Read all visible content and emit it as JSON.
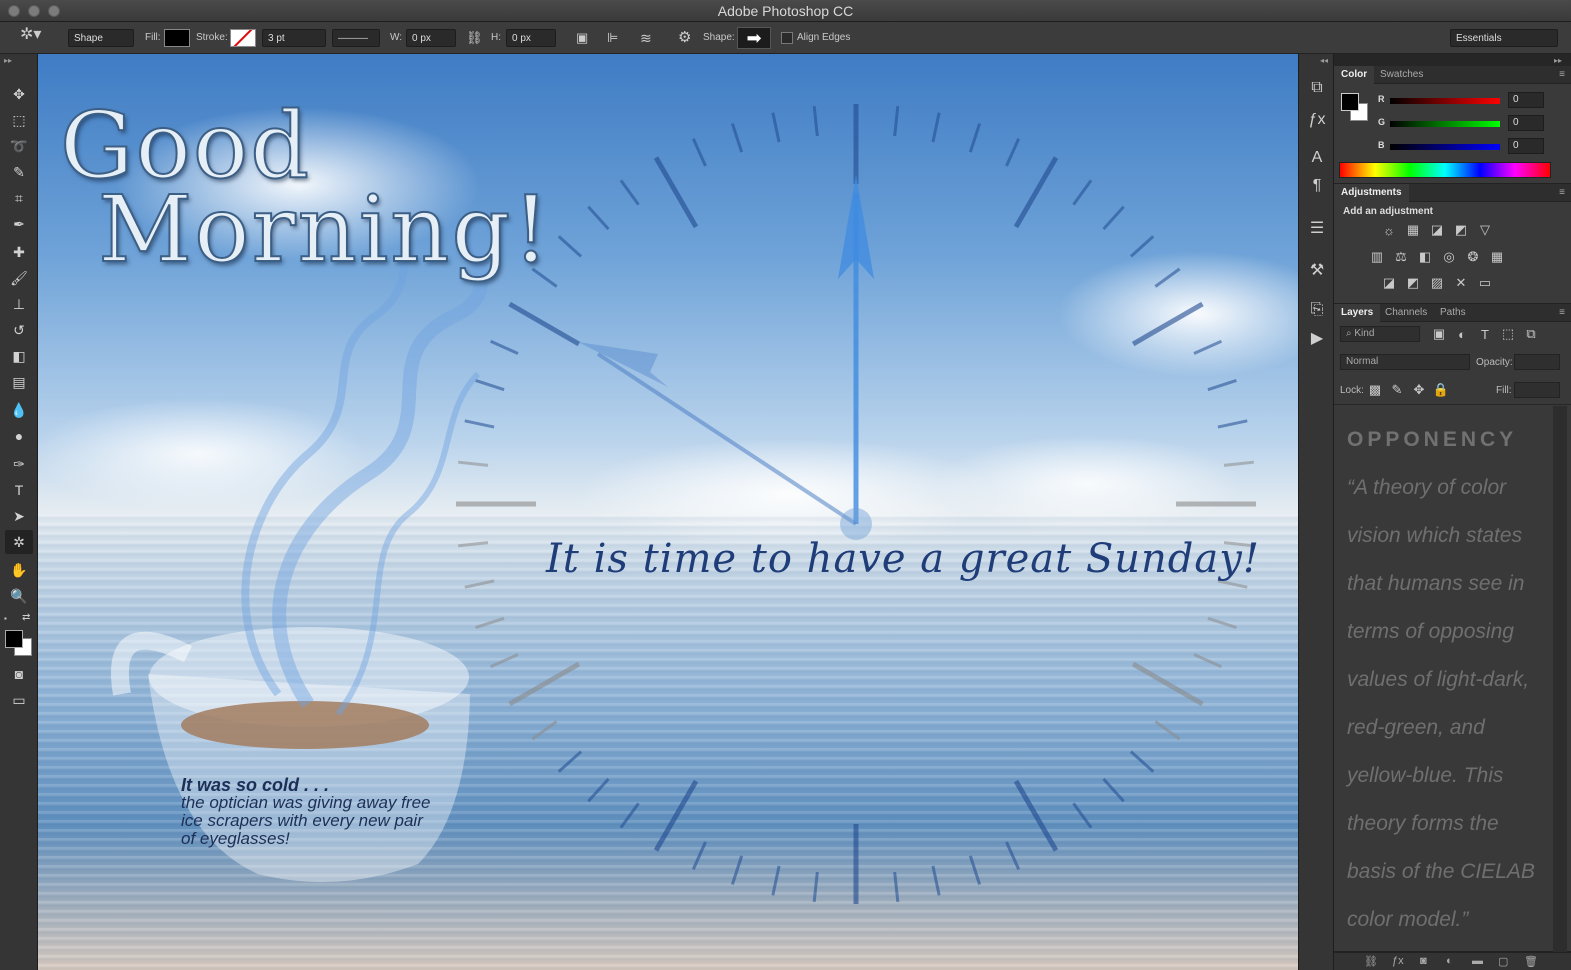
{
  "app": {
    "title": "Adobe Photoshop CC"
  },
  "options_bar": {
    "mode": "Shape",
    "fill_label": "Fill:",
    "stroke_label": "Stroke:",
    "stroke_width": "3 pt",
    "w_label": "W:",
    "w_value": "0 px",
    "h_label": "H:",
    "h_value": "0 px",
    "shape_label": "Shape:",
    "align_edges": "Align Edges",
    "workspace": "Essentials"
  },
  "canvas": {
    "title_line1": "Good",
    "title_line2": "Morning!",
    "tagline": "It is time to have a great Sunday!",
    "joke_line1": "It was so cold . . .",
    "joke_line2": "the optician was giving away free",
    "joke_line3": "ice scrapers with every new pair",
    "joke_line4": "of eyeglasses!"
  },
  "color_panel": {
    "tabs": [
      "Color",
      "Swatches"
    ],
    "r_label": "R",
    "r_value": "0",
    "g_label": "G",
    "g_value": "0",
    "b_label": "B",
    "b_value": "0"
  },
  "adjustments_panel": {
    "tab": "Adjustments",
    "heading": "Add an adjustment"
  },
  "layers_panel": {
    "tabs": [
      "Layers",
      "Channels",
      "Paths"
    ],
    "kind_filter": "Kind",
    "blend_mode": "Normal",
    "opacity_label": "Opacity:",
    "lock_label": "Lock:",
    "fill_label": "Fill:",
    "text_heading": "OPPONENCY",
    "text_lines": [
      "“A theory of color",
      "vision which states",
      "that humans see in",
      "terms of opposing",
      "values of light-dark,",
      "red-green, and",
      "yellow-blue. This",
      "theory forms the",
      "basis of the CIELAB",
      "color model.”"
    ]
  },
  "colors": {
    "ui_dark": "#353535",
    "panel": "#3a3a3a",
    "script_text": "#1f3d78",
    "clock_hand": "#3f8be0"
  }
}
